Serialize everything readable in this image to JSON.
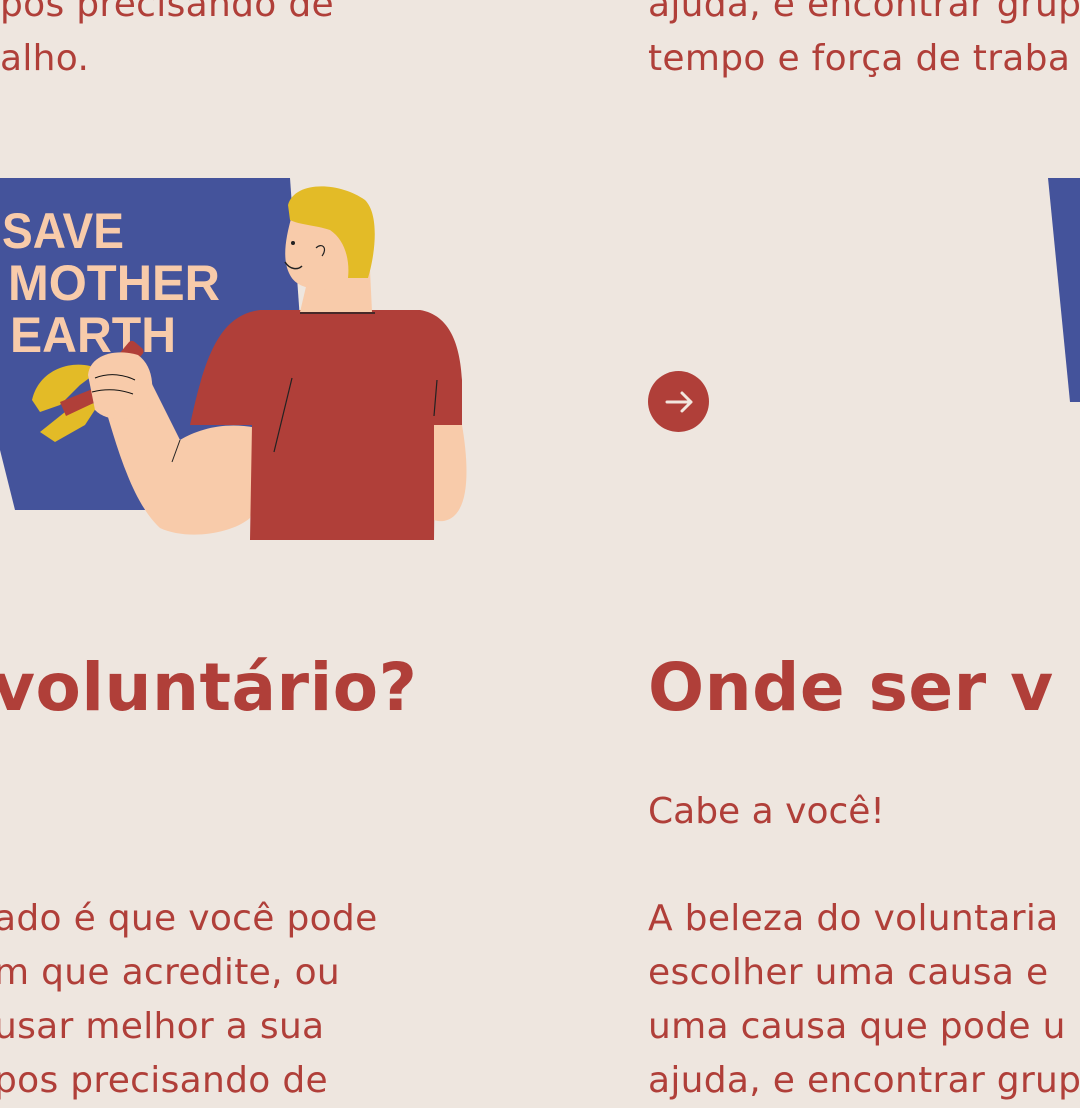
{
  "colors": {
    "background": "#EEE6DF",
    "accent": "#B03F39",
    "poster_blue": "#44539B",
    "hair_yellow": "#E3BB27",
    "skin": "#F8CBAA"
  },
  "left_column": {
    "top_line": "pos precisando de",
    "top_line_2": "alho.",
    "illustration": {
      "poster_text": [
        "SAVE",
        "MOTHER",
        "EARTH"
      ]
    },
    "heading": "voluntário?",
    "body_lines": [
      "ado é que você pode",
      "m que acredite, ou",
      "usar melhor a sua",
      "pos precisando de"
    ]
  },
  "right_column": {
    "top_line": "ajuda, e encontrar grup",
    "top_line_2": "tempo e força de traba",
    "heading": "Onde ser v",
    "subheading": "Cabe a você!",
    "body_lines": [
      "A beleza do voluntaria",
      "escolher uma causa e",
      "uma causa que pode u",
      "ajuda, e encontrar grup"
    ]
  },
  "carousel": {
    "next_icon": "arrow-right-icon"
  }
}
